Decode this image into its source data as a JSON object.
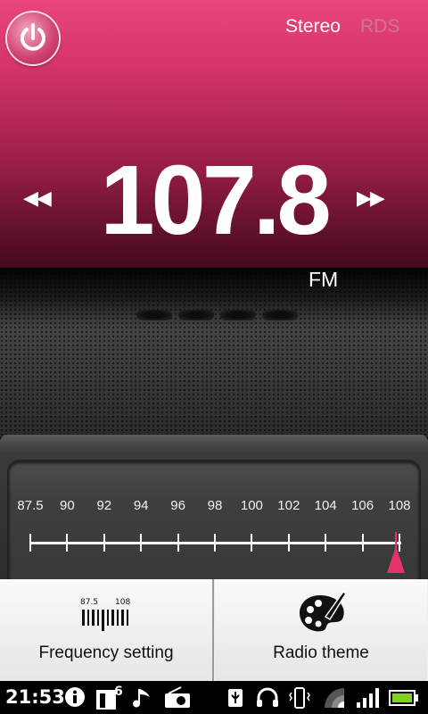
{
  "header": {
    "stereo_label": "Stereo",
    "rds_label": "RDS"
  },
  "tuner": {
    "frequency": "107.8",
    "band": "FM",
    "prev_icon": "seek-back-icon",
    "next_icon": "seek-forward-icon",
    "power_icon": "power-icon"
  },
  "dial": {
    "tick_labels": [
      "87.5",
      "90",
      "92",
      "94",
      "96",
      "98",
      "100",
      "102",
      "104",
      "106",
      "108"
    ],
    "min": 87.5,
    "max": 108,
    "current": 107.8
  },
  "bottom": {
    "frequency_setting_label": "Frequency setting",
    "frequency_icon_min": "87.5",
    "frequency_icon_max": "108",
    "radio_theme_label": "Radio theme"
  },
  "statusbar": {
    "time": "21:53",
    "calendar_day": "6",
    "icons": [
      "info-icon",
      "calendar-icon",
      "music-note-icon",
      "radio-icon",
      "usb-icon",
      "headset-icon",
      "vibrate-icon",
      "wifi-icon",
      "signal-icon",
      "battery-icon"
    ]
  },
  "colors": {
    "accent": "#e5336c",
    "header_pink": "#e9477a",
    "rds_inactive": "#c77a92"
  }
}
